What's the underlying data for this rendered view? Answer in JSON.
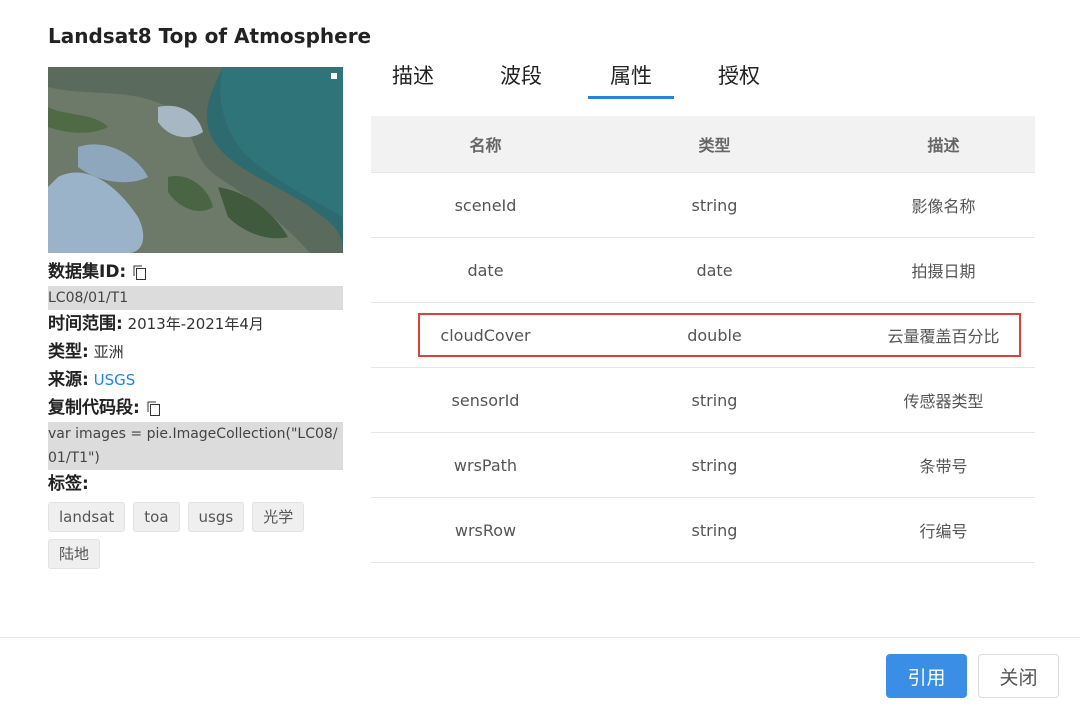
{
  "dialog": {
    "title": "Landsat8 Top of Atmosphere"
  },
  "info": {
    "dataset_id_label": "数据集ID:",
    "dataset_id_value": "LC08/01/T1",
    "time_range_label": "时间范围:",
    "time_range_value": "2013年-2021年4月",
    "type_label": "类型:",
    "type_value": "亚洲",
    "source_label": "来源:",
    "source_value": "USGS",
    "copy_code_label": "复制代码段:",
    "code_snippet": "var images = pie.ImageCollection(\"LC08/01/T1\")",
    "tags_label": "标签:",
    "tags": [
      "landsat",
      "toa",
      "usgs",
      "光学",
      "陆地"
    ]
  },
  "tabs": [
    {
      "label": "描述"
    },
    {
      "label": "波段"
    },
    {
      "label": "属性"
    },
    {
      "label": "授权"
    }
  ],
  "active_tab": "属性",
  "table": {
    "headers": [
      "名称",
      "类型",
      "描述"
    ],
    "rows": [
      [
        "sceneId",
        "string",
        "影像名称"
      ],
      [
        "date",
        "date",
        "拍摄日期"
      ],
      [
        "cloudCover",
        "double",
        "云量覆盖百分比"
      ],
      [
        "sensorId",
        "string",
        "传感器类型"
      ],
      [
        "wrsPath",
        "string",
        "条带号"
      ],
      [
        "wrsRow",
        "string",
        "行编号"
      ]
    ]
  },
  "footer": {
    "cite_label": "引用",
    "close_label": "关闭"
  },
  "colors": {
    "accent": "#3a8ee6",
    "link": "#1a85e8",
    "highlight": "#d9443a"
  },
  "icons": {
    "copy": "copy-icon"
  }
}
